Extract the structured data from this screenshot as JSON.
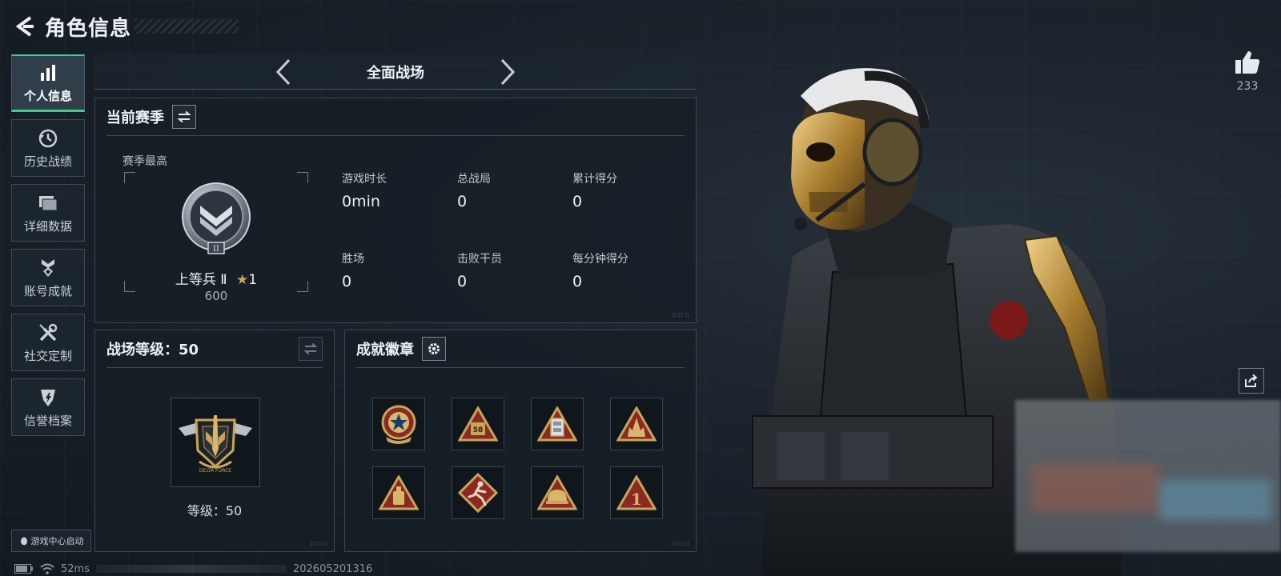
{
  "header": {
    "title": "角色信息"
  },
  "sidebar": {
    "items": [
      {
        "label": "个人信息",
        "icon": "bar-chart-icon",
        "active": true
      },
      {
        "label": "历史战绩",
        "icon": "history-clock-icon",
        "active": false
      },
      {
        "label": "详细数据",
        "icon": "data-folder-icon",
        "active": false
      },
      {
        "label": "账号成就",
        "icon": "achievement-medal-icon",
        "active": false
      },
      {
        "label": "社交定制",
        "icon": "wrench-screwdriver-icon",
        "active": false
      },
      {
        "label": "信誉档案",
        "icon": "credit-shield-icon",
        "active": false
      }
    ],
    "launcher": "游戏中心启动"
  },
  "mode": {
    "label": "全面战场"
  },
  "season": {
    "title": "当前赛季",
    "sub": "赛季最高",
    "rank_name": "上等兵 Ⅱ",
    "rank_star": "1",
    "rank_points": "600",
    "stats": [
      {
        "key": "游戏时长",
        "value": "0min"
      },
      {
        "key": "总战局",
        "value": "0"
      },
      {
        "key": "累计得分",
        "value": "0"
      },
      {
        "key": "胜场",
        "value": "0"
      },
      {
        "key": "击败干员",
        "value": "0"
      },
      {
        "key": "每分钟得分",
        "value": "0"
      }
    ]
  },
  "battlefield": {
    "title": "战场等级：50",
    "level_text": "等级：50",
    "emblem_text": "DELTA FORCE"
  },
  "badges": {
    "title": "成就徽章",
    "items": [
      {
        "icon": "star-seal-badge-icon"
      },
      {
        "icon": "crate-58-badge-icon",
        "text": "58"
      },
      {
        "icon": "locker-badge-icon"
      },
      {
        "icon": "fire-triangle-badge-icon"
      },
      {
        "icon": "bottle-badge-icon"
      },
      {
        "icon": "runner-badge-icon"
      },
      {
        "icon": "helmet-badge-icon"
      },
      {
        "icon": "number-one-badge-icon",
        "text": "1"
      }
    ]
  },
  "likes": {
    "count": "233"
  },
  "status": {
    "ping": "52ms",
    "timestamp": "202605201316"
  },
  "colors": {
    "accent": "#3fcb8c",
    "gold": "#c9a45a",
    "badge_red": "#8a2a22"
  }
}
